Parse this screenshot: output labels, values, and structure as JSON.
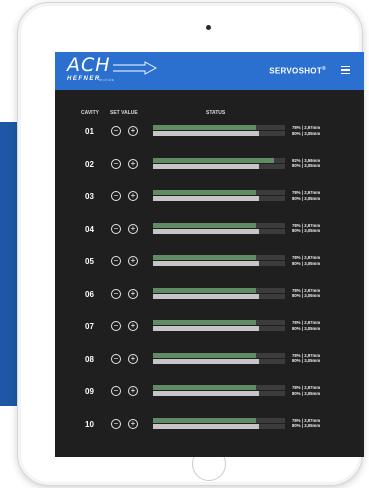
{
  "brand": {
    "logo_ach": "ACH",
    "logo_hefner": "HEFNER",
    "logo_molds": "molds",
    "app_name": "SERVOSHOT",
    "app_mark": "®"
  },
  "columns": {
    "cavity": "CAVITY",
    "set_value": "SET VALUE",
    "status": "STATUS"
  },
  "icons": {
    "minus": "−",
    "plus": "+"
  },
  "colors": {
    "header_blue": "#2b6fcf",
    "side_blue": "#1f57a6",
    "screen_bg": "#1f1f1f",
    "bar_green": "#5f8b65",
    "bar_grey": "#c6c6c6"
  },
  "rows": [
    {
      "cavity": "01",
      "top_pct": 0.78,
      "bottom_pct": 0.8,
      "line1": "78% | 2,97mm",
      "line2": "80% | 3,05mm"
    },
    {
      "cavity": "02",
      "top_pct": 0.92,
      "bottom_pct": 0.8,
      "line1": "92% | 3,59mm",
      "line2": "80% | 3,05mm"
    },
    {
      "cavity": "03",
      "top_pct": 0.78,
      "bottom_pct": 0.8,
      "line1": "78% | 2,97mm",
      "line2": "80% | 3,05mm"
    },
    {
      "cavity": "04",
      "top_pct": 0.78,
      "bottom_pct": 0.8,
      "line1": "78% | 2,97mm",
      "line2": "80% | 3,05mm"
    },
    {
      "cavity": "05",
      "top_pct": 0.78,
      "bottom_pct": 0.8,
      "line1": "78% | 2,97mm",
      "line2": "80% | 3,05mm"
    },
    {
      "cavity": "06",
      "top_pct": 0.78,
      "bottom_pct": 0.8,
      "line1": "78% | 2,97mm",
      "line2": "80% | 3,05mm"
    },
    {
      "cavity": "07",
      "top_pct": 0.78,
      "bottom_pct": 0.8,
      "line1": "78% | 2,97mm",
      "line2": "80% | 3,05mm"
    },
    {
      "cavity": "08",
      "top_pct": 0.78,
      "bottom_pct": 0.8,
      "line1": "78% | 2,97mm",
      "line2": "80% | 3,05mm"
    },
    {
      "cavity": "09",
      "top_pct": 0.78,
      "bottom_pct": 0.8,
      "line1": "78% | 2,97mm",
      "line2": "80% | 3,05mm"
    },
    {
      "cavity": "10",
      "top_pct": 0.78,
      "bottom_pct": 0.8,
      "line1": "78% | 2,97mm",
      "line2": "80% | 3,05mm"
    }
  ]
}
